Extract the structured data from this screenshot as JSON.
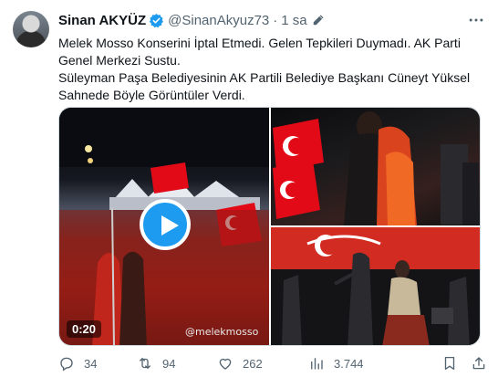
{
  "tweet": {
    "author_name": "Sinan AKYÜZ",
    "handle": "@SinanAkyuz73",
    "separator": "·",
    "time": "1 sa",
    "text_lines": [
      "Melek Mosso Konserini İptal Etmedi. Gelen Tepkileri Duymadı. AK Parti Genel Merkezi Sustu.",
      "Süleyman Paşa Belediyesinin AK Partili Belediye Başkanı Cüneyt Yüksel Sahnede Böyle Görüntüler Verdi."
    ],
    "video_duration": "0:20",
    "watermark": "@melekmosso",
    "stats": {
      "replies": "34",
      "retweets": "94",
      "likes": "262",
      "views": "3.744"
    }
  },
  "colors": {
    "accent": "#1d9bf0",
    "muted": "#536471",
    "text": "#0f1419",
    "flag_red": "#e30a17"
  },
  "icons": [
    "verified-badge-icon",
    "edit-icon",
    "more-icon",
    "play-icon",
    "reply-icon",
    "retweet-icon",
    "like-icon",
    "views-icon",
    "bookmark-icon",
    "share-icon"
  ]
}
